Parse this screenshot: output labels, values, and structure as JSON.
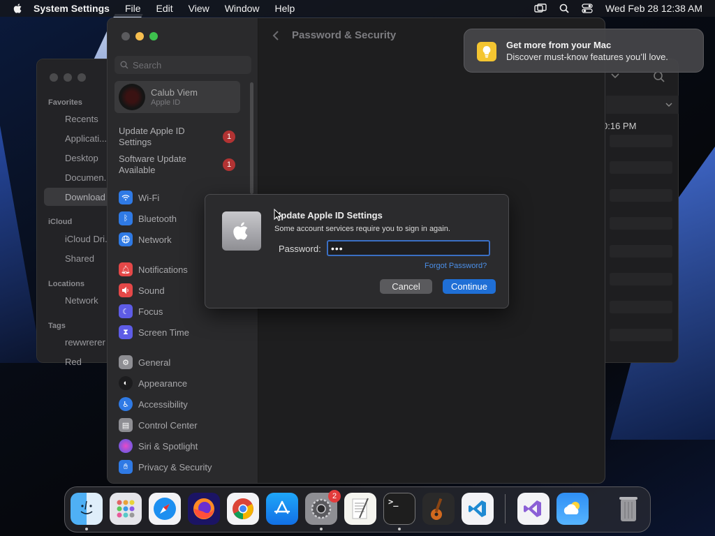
{
  "menubar": {
    "app_name": "System Settings",
    "menus": [
      "File",
      "Edit",
      "View",
      "Window",
      "Help"
    ],
    "clock": "Wed Feb 28  12:38 AM"
  },
  "finder": {
    "sections": [
      "Favorites",
      "iCloud",
      "Locations",
      "Tags"
    ],
    "favorites": [
      "Recents",
      "Applicati...",
      "Desktop",
      "Documen...",
      "Download"
    ],
    "icloud": [
      "iCloud Dri...",
      "Shared"
    ],
    "locations": [
      "Network"
    ],
    "tags": [
      "rewwrerer",
      "Red"
    ],
    "partial_time": "0:16 PM"
  },
  "settings": {
    "search_placeholder": "Search",
    "account": {
      "name": "Calub Viem",
      "subtitle": "Apple ID"
    },
    "notices": [
      {
        "label": "Update Apple ID Settings",
        "badge": "1"
      },
      {
        "label": "Software Update Available",
        "badge": "1"
      }
    ],
    "items": [
      {
        "label": "Wi-Fi",
        "icon": "wifi-icon",
        "color": "#2f7ae5"
      },
      {
        "label": "Bluetooth",
        "icon": "bluetooth-icon",
        "color": "#2f7ae5"
      },
      {
        "label": "Network",
        "icon": "globe-icon",
        "color": "#2f7ae5"
      },
      {
        "label": "Notifications",
        "icon": "bell-icon",
        "color": "#e54848"
      },
      {
        "label": "Sound",
        "icon": "speaker-icon",
        "color": "#e54848"
      },
      {
        "label": "Focus",
        "icon": "moon-icon",
        "color": "#5e5ce6"
      },
      {
        "label": "Screen Time",
        "icon": "hourglass-icon",
        "color": "#5e5ce6"
      },
      {
        "label": "General",
        "icon": "gear-icon",
        "color": "#8e8e93"
      },
      {
        "label": "Appearance",
        "icon": "appearance-icon",
        "color": "#1c1c1e"
      },
      {
        "label": "Accessibility",
        "icon": "accessibility-icon",
        "color": "#2f7ae5"
      },
      {
        "label": "Control Center",
        "icon": "control-center-icon",
        "color": "#8e8e93"
      },
      {
        "label": "Siri & Spotlight",
        "icon": "siri-icon",
        "color": "#c05bd1"
      },
      {
        "label": "Privacy & Security",
        "icon": "hand-icon",
        "color": "#2f7ae5"
      }
    ],
    "page_title": "Password & Security"
  },
  "notification": {
    "title": "Get more from your Mac",
    "subtitle": "Discover must-know features you’ll love."
  },
  "dialog": {
    "title": "Update Apple ID Settings",
    "message": "Some account services require you to sign in again.",
    "password_label": "Password:",
    "password_value": "•••",
    "forgot": "Forgot Password?",
    "cancel": "Cancel",
    "continue": "Continue"
  },
  "dock": {
    "settings_badge": "2",
    "apps": [
      "finder",
      "launchpad",
      "safari",
      "firefox",
      "chrome",
      "app-store",
      "system-settings",
      "textedit",
      "terminal",
      "garageband",
      "vscode",
      "visual-studio",
      "weather",
      "trash"
    ]
  }
}
